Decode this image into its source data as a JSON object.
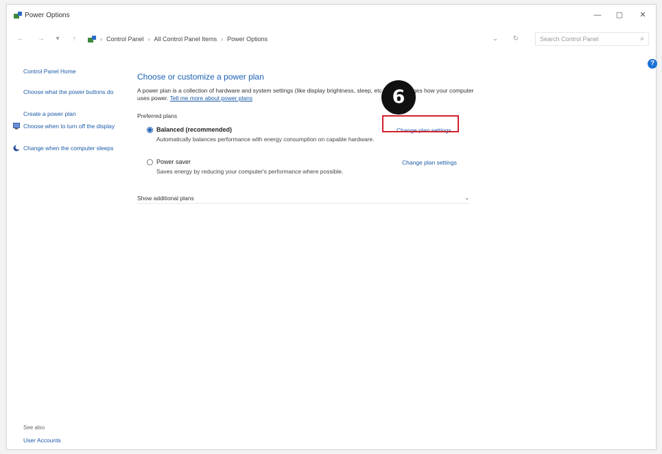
{
  "window": {
    "title": "Power Options",
    "controls": {
      "minimize": "—",
      "maximize": "▢",
      "close": "✕"
    }
  },
  "navbar": {
    "back": "←",
    "forward": "→",
    "recent": "▾",
    "up": "↑",
    "breadcrumb": [
      "Control Panel",
      "All Control Panel Items",
      "Power Options"
    ],
    "breadcrumb_prefix": "›",
    "separator": "›",
    "dropdown": "⌄",
    "refresh": "↻",
    "search_placeholder": "Search Control Panel",
    "search_icon": "⌕"
  },
  "help": {
    "label": "?"
  },
  "sidebar": {
    "home": "Control Panel Home",
    "links": [
      {
        "label": "Choose what the power buttons do",
        "icon": ""
      },
      {
        "label": "Create a power plan",
        "icon": ""
      },
      {
        "label": "Choose when to turn off the display",
        "icon": "monitor-icon"
      },
      {
        "label": "Change when the computer sleeps",
        "icon": "moon-icon"
      }
    ],
    "see_also": "See also",
    "footer_link": "User Accounts"
  },
  "main": {
    "heading": "Choose or customize a power plan",
    "description": "A power plan is a collection of hardware and system settings (like display brightness, sleep, etc.) that manages how your computer uses power.",
    "description_link": "Tell me more about power plans",
    "preferred_label": "Preferred plans",
    "plans": [
      {
        "name": "Balanced (recommended)",
        "selected": true,
        "description": "Automatically balances performance with energy consumption on capable hardware.",
        "change_link": "Change plan settings"
      },
      {
        "name": "Power saver",
        "selected": false,
        "description": "Saves energy by reducing your computer's performance where possible.",
        "change_link": "Change plan settings"
      }
    ],
    "show_more": "Show additional plans",
    "show_more_chevron": "⌄"
  },
  "annotation": {
    "step": "6",
    "highlight_color": "#d11e2a"
  },
  "colors": {
    "link": "#1b5aa8",
    "heading": "#1a5fb4",
    "accent": "#1b72d6"
  }
}
